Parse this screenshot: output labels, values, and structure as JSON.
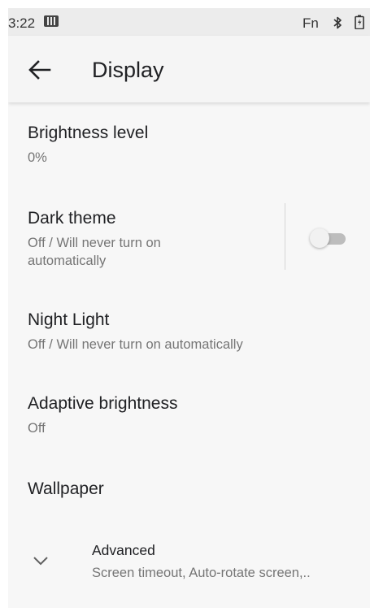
{
  "status_bar": {
    "time": "3:22",
    "fn_label": "Fn",
    "icons": [
      "sim-card-icon",
      "bluetooth-icon",
      "battery-charging-icon"
    ]
  },
  "app_bar": {
    "title": "Display",
    "back_icon": "arrow-left-icon"
  },
  "preferences": {
    "brightness": {
      "title": "Brightness level",
      "summary": "0%"
    },
    "dark_theme": {
      "title": "Dark theme",
      "summary_line1": "Off / Will never turn on",
      "summary_line2": "automatically",
      "enabled": false
    },
    "night_light": {
      "title": "Night Light",
      "summary": "Off / Will never turn on automatically"
    },
    "adaptive_brightness": {
      "title": "Adaptive brightness",
      "summary": "Off"
    },
    "wallpaper": {
      "title": "Wallpaper"
    },
    "advanced": {
      "title": "Advanced",
      "summary": "Screen timeout, Auto-rotate screen,..",
      "icon": "chevron-down-icon"
    }
  },
  "colors": {
    "background": "#f7f7f7",
    "status_bar": "#ececec",
    "primary_text": "#202124",
    "secondary_text": "#757575",
    "toggle_off_track": "#bdbdbd"
  }
}
